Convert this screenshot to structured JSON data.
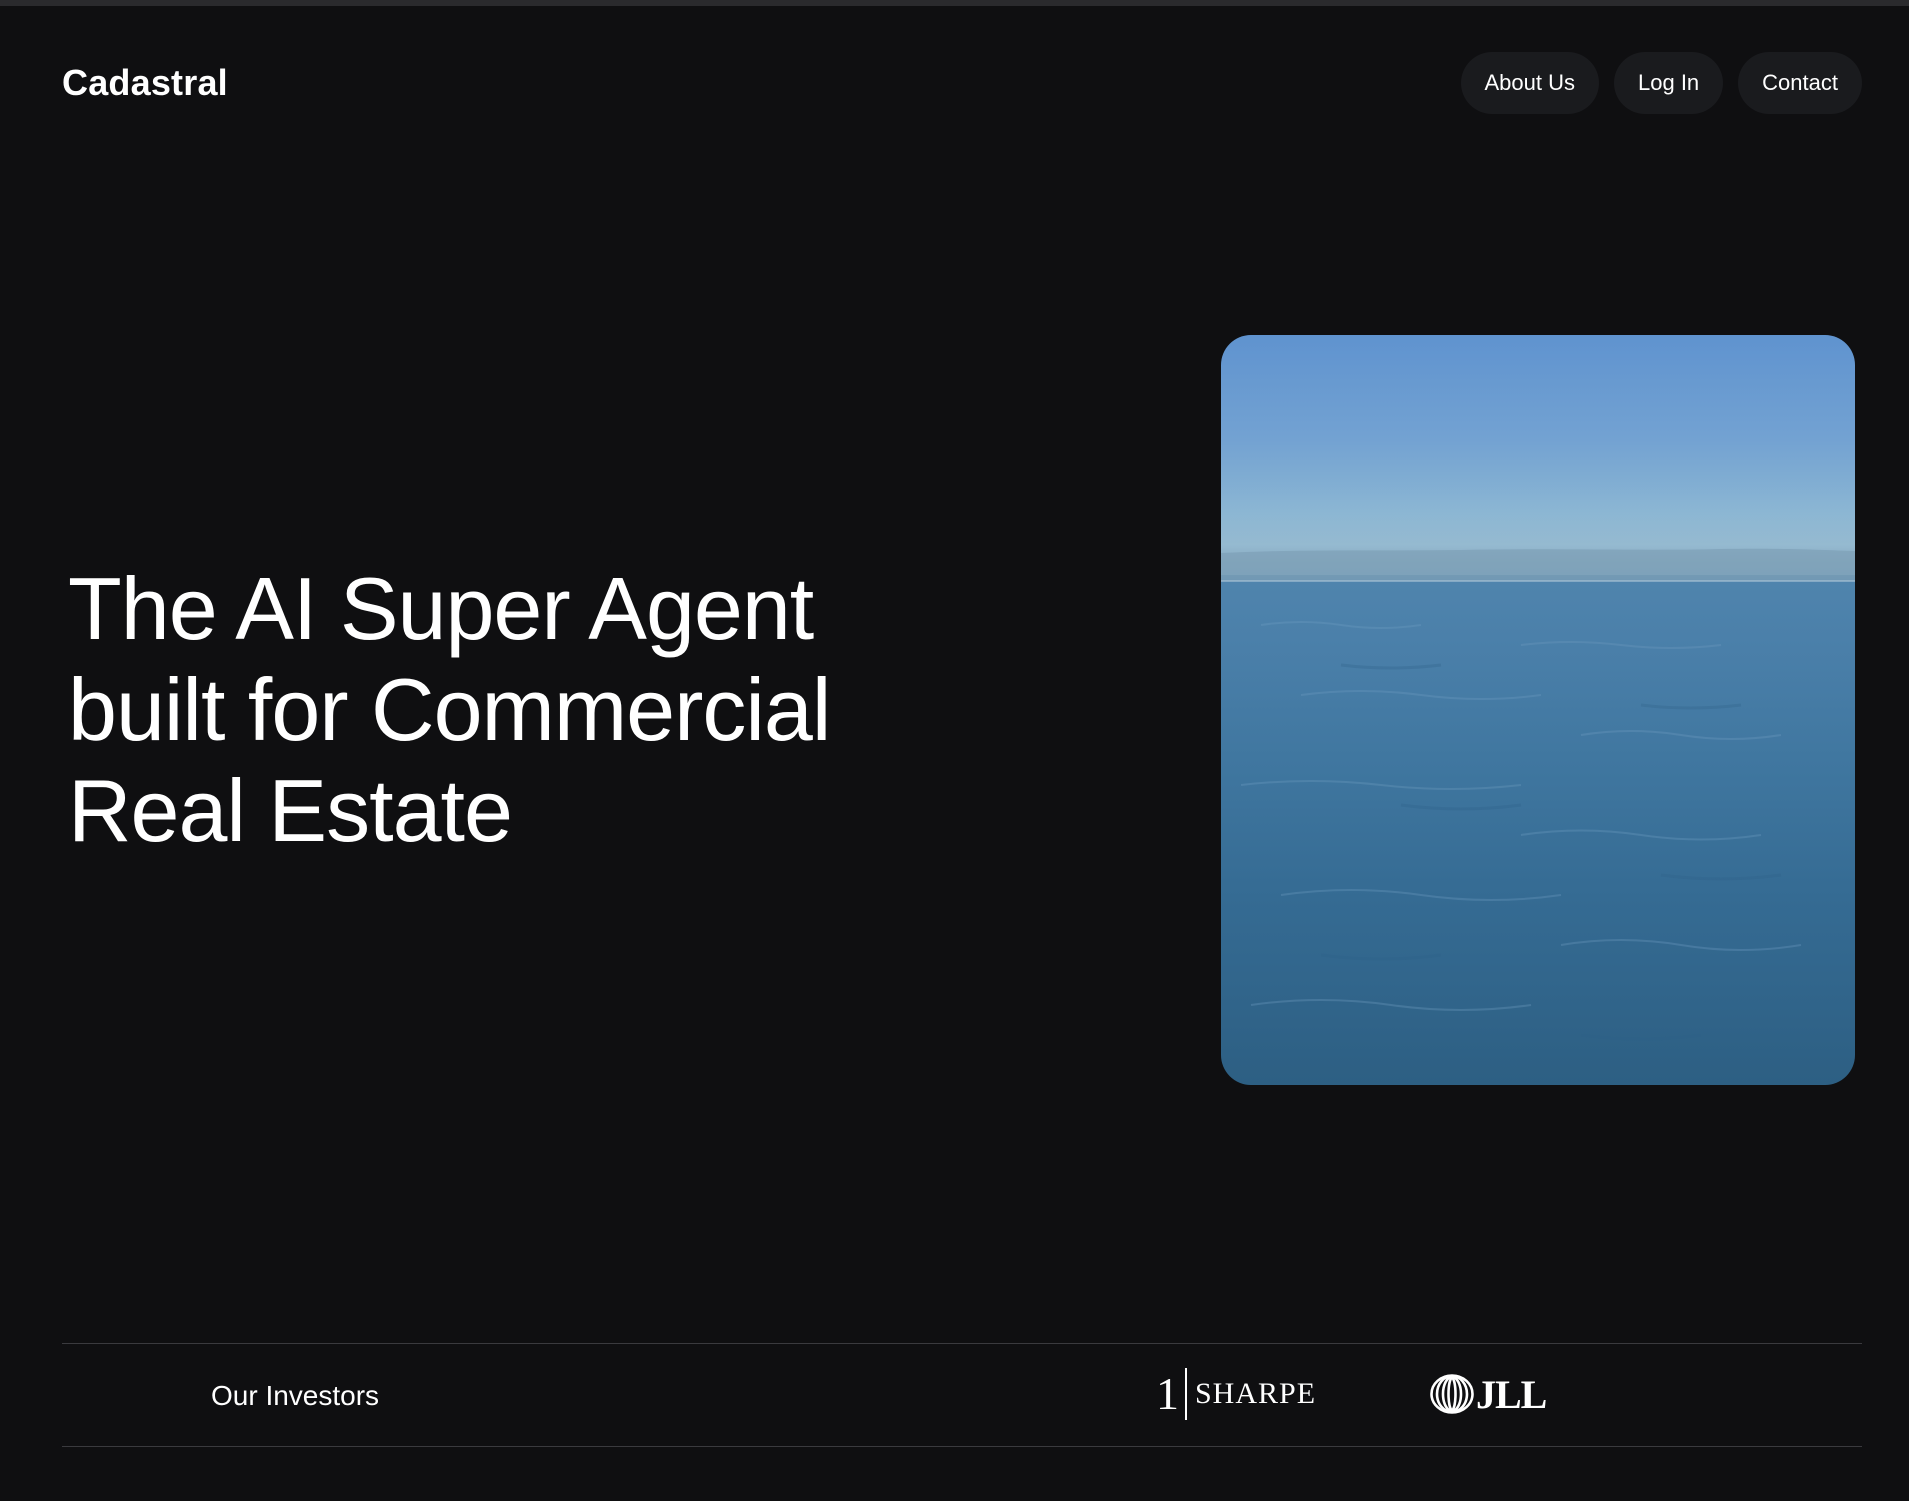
{
  "header": {
    "brand": "Cadastral",
    "nav": [
      {
        "label": "About Us"
      },
      {
        "label": "Log In"
      },
      {
        "label": "Contact"
      }
    ]
  },
  "hero": {
    "title_lines": [
      "The AI Super Agent",
      "built for Commercial",
      "Real Estate"
    ],
    "media": "ocean-video"
  },
  "investors": {
    "label": "Our Investors",
    "logos": [
      {
        "prefix": "1",
        "name": "SHARPE"
      },
      {
        "name": "JLL"
      }
    ]
  },
  "colors": {
    "background": "#0f0f11",
    "nav_button": "#1a1b1e",
    "divider": "#3a3a3e",
    "text": "#ffffff"
  }
}
